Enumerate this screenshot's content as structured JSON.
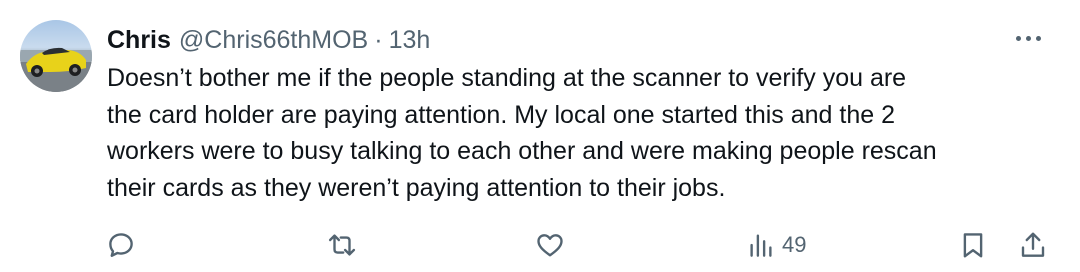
{
  "tweet": {
    "author": {
      "name": "Chris",
      "handle": "@Chris66thMOB",
      "separator": "·",
      "time": "13h"
    },
    "text_lines": [
      "Doesn’t bother me if the people standing at the scanner to verify you are",
      "the card holder are paying attention. My local one started this and the 2",
      "workers were to busy talking to each other and were making people rescan",
      "their cards as they weren’t paying attention to their jobs."
    ],
    "actions": {
      "reply": {
        "icon": "reply-icon"
      },
      "retweet": {
        "icon": "retweet-icon"
      },
      "like": {
        "icon": "heart-icon"
      },
      "views": {
        "icon": "views-icon",
        "count": "49"
      },
      "bookmark": {
        "icon": "bookmark-icon"
      },
      "share": {
        "icon": "share-icon"
      }
    }
  },
  "colors": {
    "text_primary": "#0f1419",
    "text_secondary": "#536471",
    "background": "#ffffff"
  }
}
